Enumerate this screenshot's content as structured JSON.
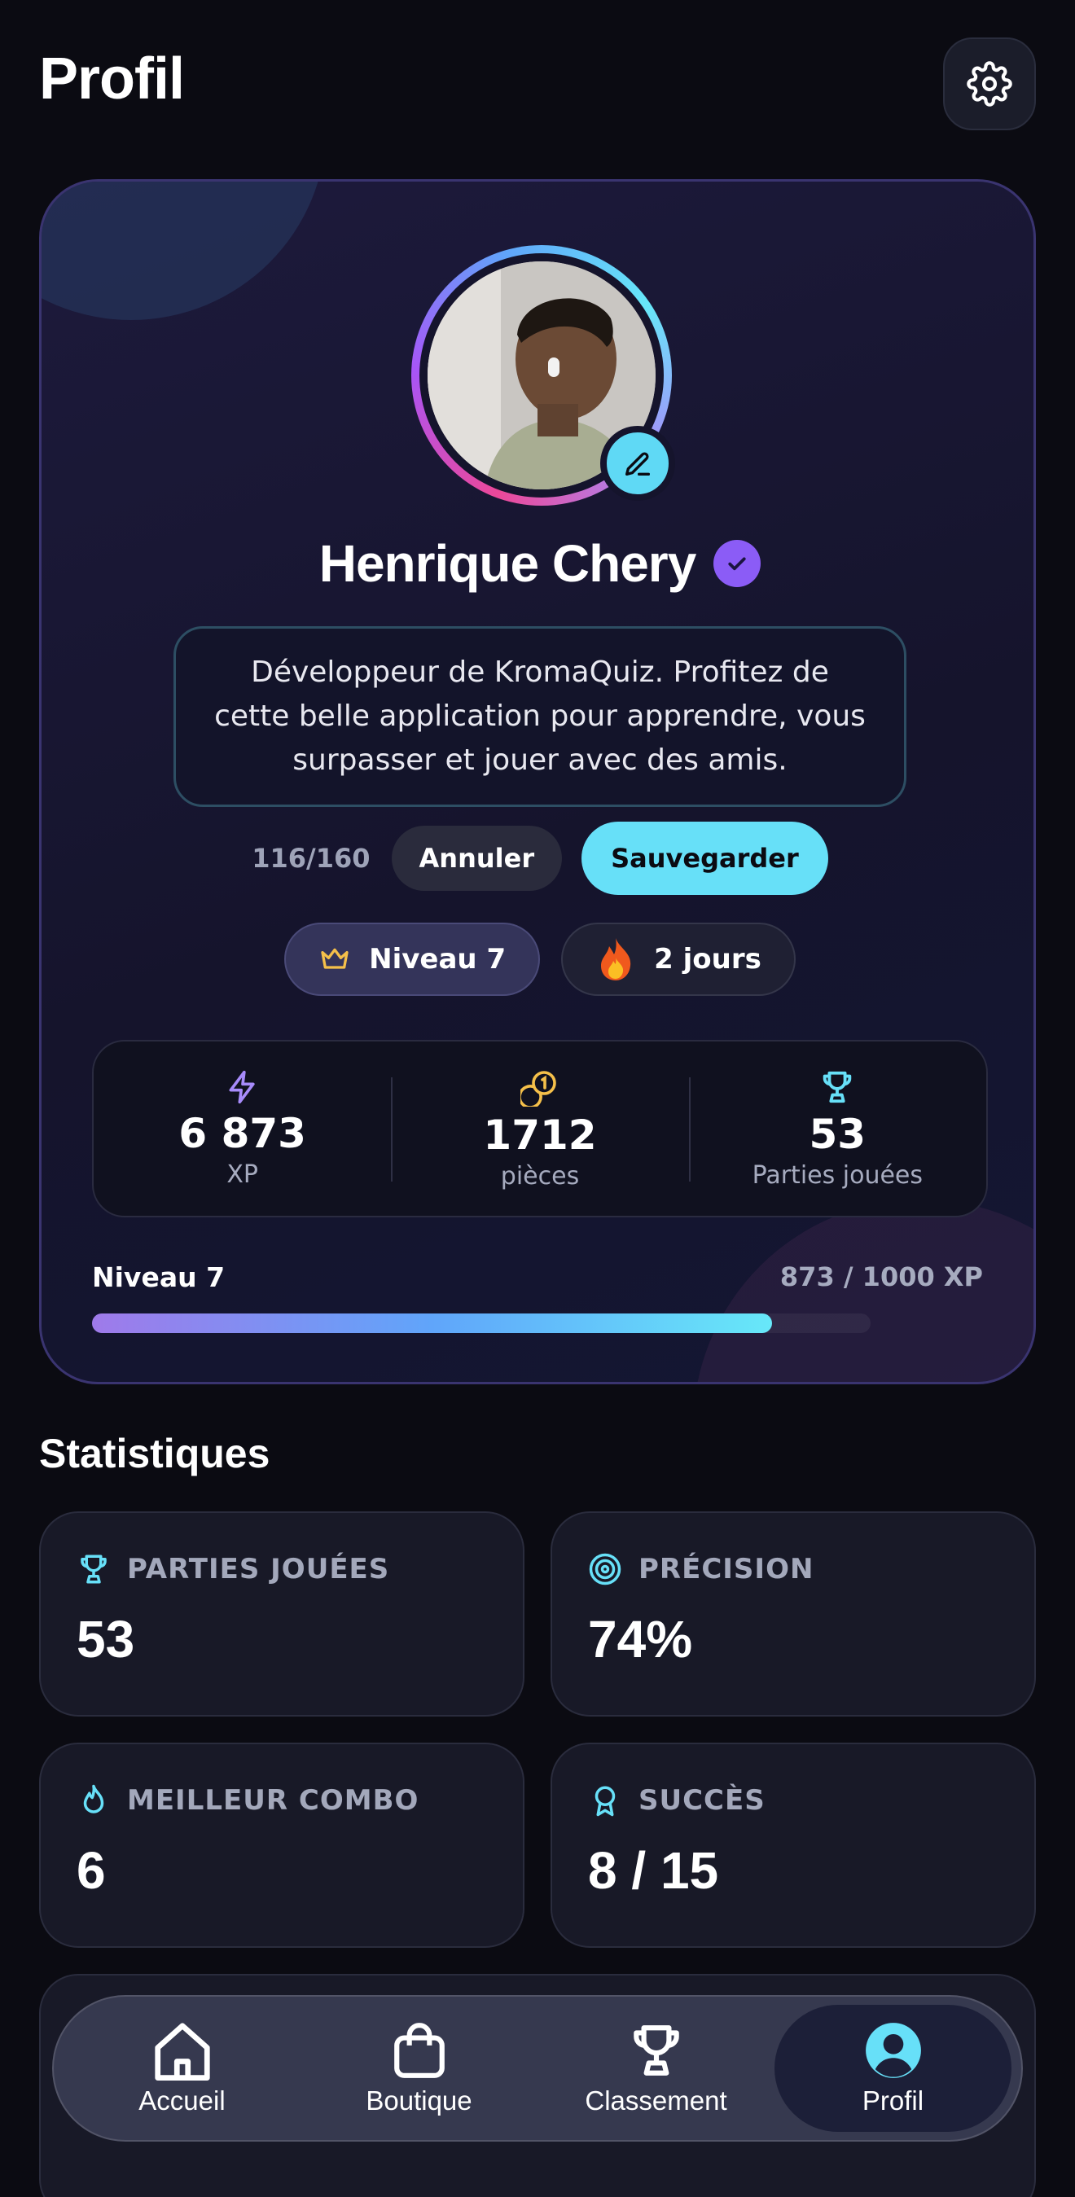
{
  "header": {
    "title": "Profil"
  },
  "profile": {
    "name": "Henrique Chery",
    "bio": "Développeur de KromaQuiz. Profitez de cette belle application pour apprendre, vous surpasser et jouer avec des amis.",
    "char_count": "116/160",
    "cancel_label": "Annuler",
    "save_label": "Sauvegarder",
    "level_badge": "Niveau 7",
    "streak_badge": "2 jours"
  },
  "summary": {
    "xp_value": "6 873",
    "xp_label": "XP",
    "coins_value": "1712",
    "coins_label": "pièces",
    "games_value": "53",
    "games_label": "Parties jouées"
  },
  "progress": {
    "level_label": "Niveau 7",
    "xp_text": "873 / 1000 XP",
    "fraction": 0.873
  },
  "stats": {
    "title": "Statistiques",
    "games_title": "PARTIES JOUÉES",
    "games_value": "53",
    "accuracy_title": "PRÉCISION",
    "accuracy_value": "74%",
    "combo_title": "MEILLEUR COMBO",
    "combo_value": "6",
    "success_title": "SUCCÈS",
    "success_value": "8 / 15"
  },
  "nav": {
    "home": "Accueil",
    "shop": "Boutique",
    "ranking": "Classement",
    "profile": "Profil"
  },
  "colors": {
    "accent_cyan": "#67e0f8",
    "accent_purple": "#8b5cf6",
    "background": "#0b0b12"
  },
  "icons": {
    "settings": "gear-icon",
    "edit": "pencil-icon",
    "verified": "check-icon",
    "level": "crown-icon",
    "streak": "fire-icon",
    "xp": "lightning-icon",
    "coins": "coins-icon",
    "games": "trophy-icon",
    "accuracy": "target-icon",
    "combo": "flame-icon",
    "success": "medal-icon"
  }
}
